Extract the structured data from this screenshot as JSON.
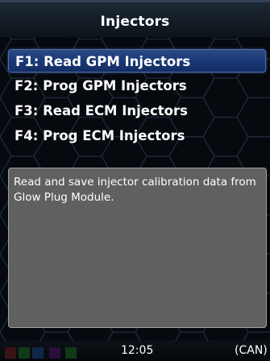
{
  "header": {
    "title": "Injectors"
  },
  "menu": {
    "items": [
      {
        "label": "F1: Read GPM Injectors",
        "selected": true
      },
      {
        "label": "F2: Prog GPM Injectors",
        "selected": false
      },
      {
        "label": "F3: Read ECM Injectors",
        "selected": false
      },
      {
        "label": "F4: Prog ECM Injectors",
        "selected": false
      }
    ]
  },
  "description": {
    "text": "Read and save injector calibration data from Glow Plug Module."
  },
  "status_bar": {
    "indicator_colors": [
      "#3a1414",
      "#0f3a18",
      "#102848",
      "#2a0f3a",
      "#0f3a18"
    ],
    "time": "12:05",
    "connection": "(CAN)"
  },
  "colors": {
    "selection": "#1b3a78",
    "description_bg": "#606060",
    "background": "#06090d"
  }
}
